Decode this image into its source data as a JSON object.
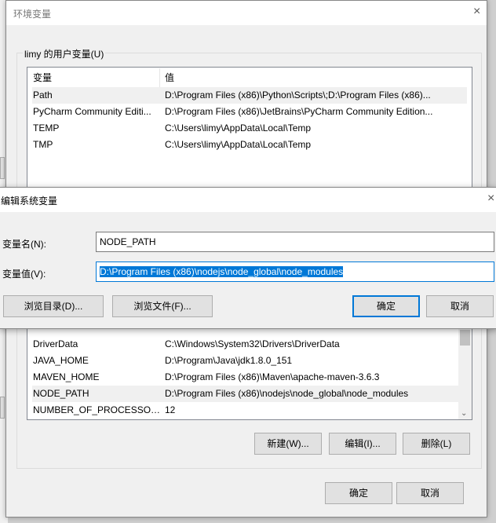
{
  "env_window": {
    "title": "环境变量",
    "user_group_label": "limy 的用户变量(U)",
    "columns": [
      "变量",
      "值"
    ],
    "user_vars": [
      {
        "name": "Path",
        "value": "D:\\Program Files (x86)\\Python\\Scripts\\;D:\\Program Files (x86)..."
      },
      {
        "name": "PyCharm Community Editi...",
        "value": "D:\\Program Files (x86)\\JetBrains\\PyCharm Community Edition..."
      },
      {
        "name": "TEMP",
        "value": "C:\\Users\\limy\\AppData\\Local\\Temp"
      },
      {
        "name": "TMP",
        "value": "C:\\Users\\limy\\AppData\\Local\\Temp"
      }
    ],
    "system_vars": [
      {
        "name": "DriverData",
        "value": "C:\\Windows\\System32\\Drivers\\DriverData"
      },
      {
        "name": "JAVA_HOME",
        "value": "D:\\Program\\Java\\jdk1.8.0_151"
      },
      {
        "name": "MAVEN_HOME",
        "value": "D:\\Program Files (x86)\\Maven\\apache-maven-3.6.3"
      },
      {
        "name": "NODE_PATH",
        "value": "D:\\Program Files (x86)\\nodejs\\node_global\\node_modules"
      },
      {
        "name": "NUMBER_OF_PROCESSORS",
        "value": "12"
      }
    ],
    "new_label": "新建(W)...",
    "edit_label": "编辑(I)...",
    "delete_label": "删除(L)",
    "ok_label": "确定",
    "cancel_label": "取消",
    "close_icon": "×"
  },
  "edit_dialog": {
    "title": "编辑系统变量",
    "name_label": "变量名(N):",
    "name_value": "NODE_PATH",
    "value_label": "变量值(V):",
    "value_value": "D:\\Program Files (x86)\\nodejs\\node_global\\node_modules",
    "browse_dir_label": "浏览目录(D)...",
    "browse_file_label": "浏览文件(F)...",
    "ok_label": "确定",
    "cancel_label": "取消",
    "close_icon": "×",
    "accent": "#0078d7"
  }
}
